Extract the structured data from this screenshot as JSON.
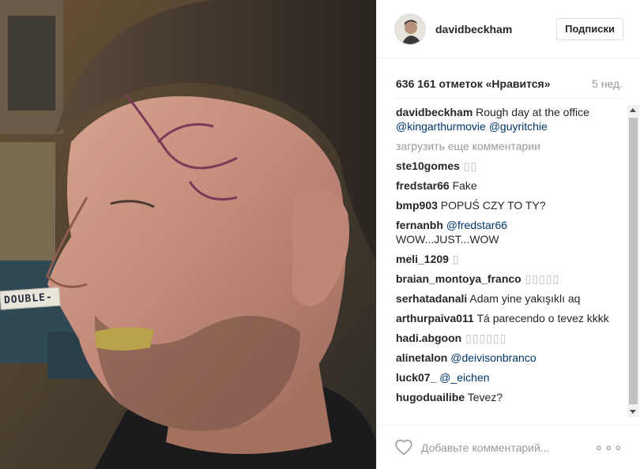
{
  "post": {
    "photo_tag": "DOUBLE-",
    "username": "davidbeckham",
    "follow_label": "Подписки",
    "likes": "636 161 отметок «Нравится»",
    "time": "5 нед.",
    "caption": {
      "user": "davidbeckham",
      "text": " Rough day at the office ",
      "mentions": [
        "@kingarthurmovie",
        "@guyritchie"
      ]
    },
    "load_more": "загрузить еще комментарии",
    "comments": [
      {
        "user": "ste10gomes",
        "text": " ▯▯"
      },
      {
        "user": "fredstar66",
        "text": " Fake"
      },
      {
        "user": "bmp903",
        "text": " POPUŚ CZY TO TY?"
      },
      {
        "user": "fernanbh",
        "mention": "@fredstar66",
        "text": "WOW...JUST...WOW"
      },
      {
        "user": "meli_1209",
        "text": " ▯"
      },
      {
        "user": "braian_montoya_franco",
        "text": " ▯▯▯▯▯"
      },
      {
        "user": "serhatadanali",
        "text": " Adam yine yakışıklı aq"
      },
      {
        "user": "arthurpaiva011",
        "text": " Tá parecendo o tevez kkkk"
      },
      {
        "user": "hadi.abgoon",
        "text": " ▯▯▯▯▯▯"
      },
      {
        "user": "alinetalon",
        "mention": "@deivisonbranco"
      },
      {
        "user": "luck07_",
        "mention": "@_eichen"
      },
      {
        "user": "hugoduailibe",
        "text": " Tevez?"
      }
    ],
    "comment_placeholder": "Добавьте комментарий...",
    "more_label": "∘∘∘",
    "icons": {
      "heart": "heart-icon",
      "more": "more-options-icon"
    }
  }
}
